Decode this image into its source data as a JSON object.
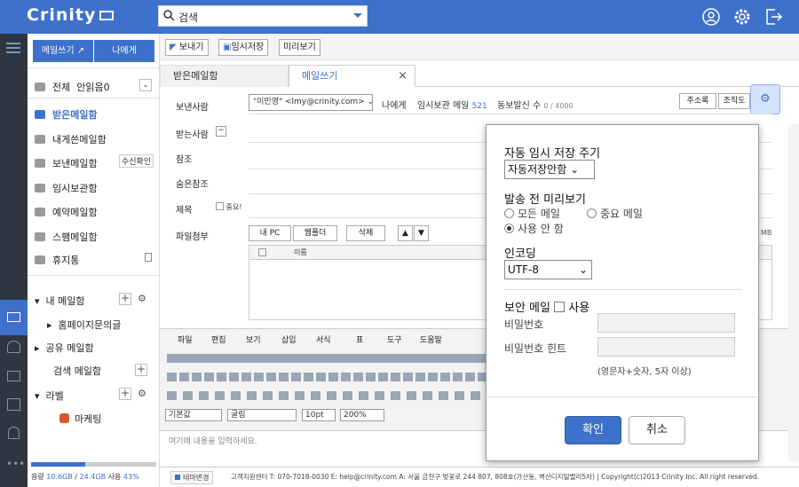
{
  "app": {
    "logo": "Crinity"
  },
  "search": {
    "placeholder": "검색"
  },
  "sidebar": {
    "compose": "메일쓰기",
    "to_me": "나에게",
    "all": "전체",
    "unread": "안읽음0",
    "items": [
      {
        "label": "받은메일함"
      },
      {
        "label": "내게쓴메일함"
      },
      {
        "label": "보낸메일함",
        "badge": "수신확인"
      },
      {
        "label": "임시보관함"
      },
      {
        "label": "예약메일함"
      },
      {
        "label": "스팸메일함"
      },
      {
        "label": "휴지통"
      }
    ],
    "my_mailbox": "내 메일함",
    "homepage_folder": "홈페이지문의글",
    "shared": "공유 메일함",
    "search_mailbox": "검색 메일함",
    "labels": "라벨",
    "label_marketing": "마케팅",
    "marketing_color": "#d9552b"
  },
  "storage": {
    "label": "용량",
    "used": "10.6GB",
    "total": "24.4GB",
    "usage_label": "사용",
    "percent": "43%",
    "fraction": 0.43
  },
  "toolbar": {
    "send": "보내기",
    "save_draft": "임시저장",
    "preview": "미리보기"
  },
  "tabs": {
    "inbox": "받은메일함",
    "compose": "메일쓰기",
    "close": "×"
  },
  "compose": {
    "sender_label": "보낸사람",
    "sender_value": "\"이민영\" <lmy@crinity.com>",
    "to_me": "나에게",
    "drafts_label": "임시보관 메일",
    "drafts_count": "521",
    "cc_count_label": "동보발신 수",
    "cc_count": "0 / 4000",
    "address_book": "주소록",
    "org_chart": "조직도",
    "recipient_label": "받는사람",
    "cc_label": "참조",
    "bcc_label": "숨은참조",
    "subject_label": "제목",
    "important": "중요!",
    "attach_label": "파일첨부",
    "my_pc": "내 PC",
    "web_folder": "웹폴더",
    "delete": "삭제",
    "col_name": "이름",
    "mb": "MB"
  },
  "editor": {
    "menus": [
      "파일",
      "편집",
      "보기",
      "삽입",
      "서식",
      "표",
      "도구",
      "도움말"
    ],
    "font": "기본값",
    "font_face": "굴림",
    "size": "10pt",
    "zoom": "200%",
    "placeholder": "여기에 내용을 입력하세요."
  },
  "footer": {
    "theme": "테마변경",
    "info": "고객지원센터 T: 070-7018-0030 E: help@crinity.com A: 서울 금천구 벚꽃로 244 807, 808호(가산동, 벽산디지털밸리5차) | Copyright(c)2013 Crinity Inc. All right reserved."
  },
  "dialog": {
    "autosave_title": "자동 임시 저장 주기",
    "autosave_value": "자동저장안함",
    "preview_title": "발송 전 미리보기",
    "preview_opt1": "모든 메일",
    "preview_opt2": "중요 메일",
    "preview_opt3": "사용 안 함",
    "encoding_title": "인코딩",
    "encoding_value": "UTF-8",
    "secure_title": "보안 메일",
    "secure_use": "사용",
    "password_label": "비밀번호",
    "password_hint_label": "비밀번호 힌트",
    "password_rule": "(영문자+숫자, 5자 이상)",
    "ok": "확인",
    "cancel": "취소"
  },
  "colors": {
    "accent": "#3e71c9"
  }
}
